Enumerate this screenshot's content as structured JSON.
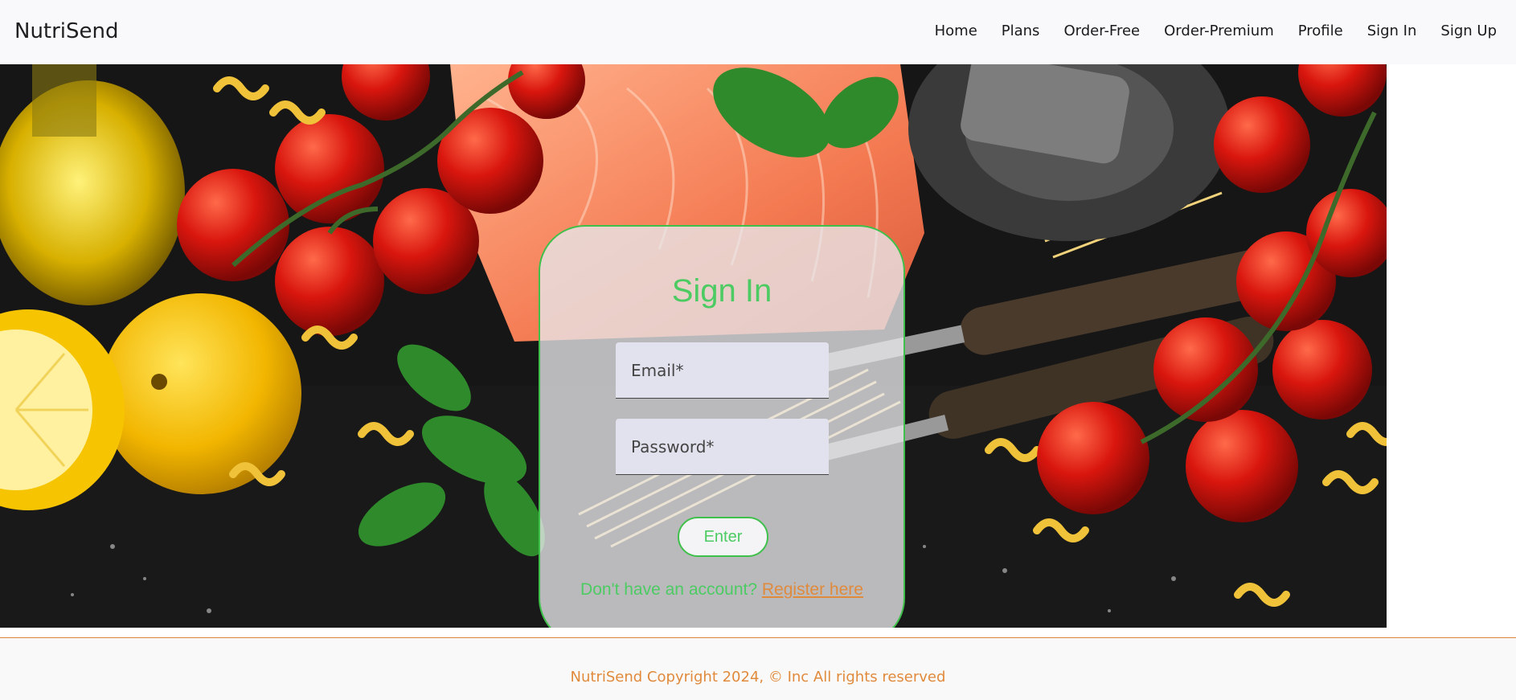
{
  "header": {
    "brand": "NutriSend",
    "nav": [
      "Home",
      "Plans",
      "Order-Free",
      "Order-Premium",
      "Profile",
      "Sign In",
      "Sign Up"
    ]
  },
  "signin": {
    "title": "Sign In",
    "email_placeholder": "Email*",
    "password_placeholder": "Password*",
    "enter_label": "Enter",
    "register_prompt": "Don't have an account?",
    "register_link": "Register here"
  },
  "footer": {
    "copyright": "NutriSend Copyright 2024, © Inc All rights reserved"
  },
  "colors": {
    "accent_green": "#4ccb62",
    "border_green": "#3fc04a",
    "accent_orange": "#e08a3c"
  }
}
